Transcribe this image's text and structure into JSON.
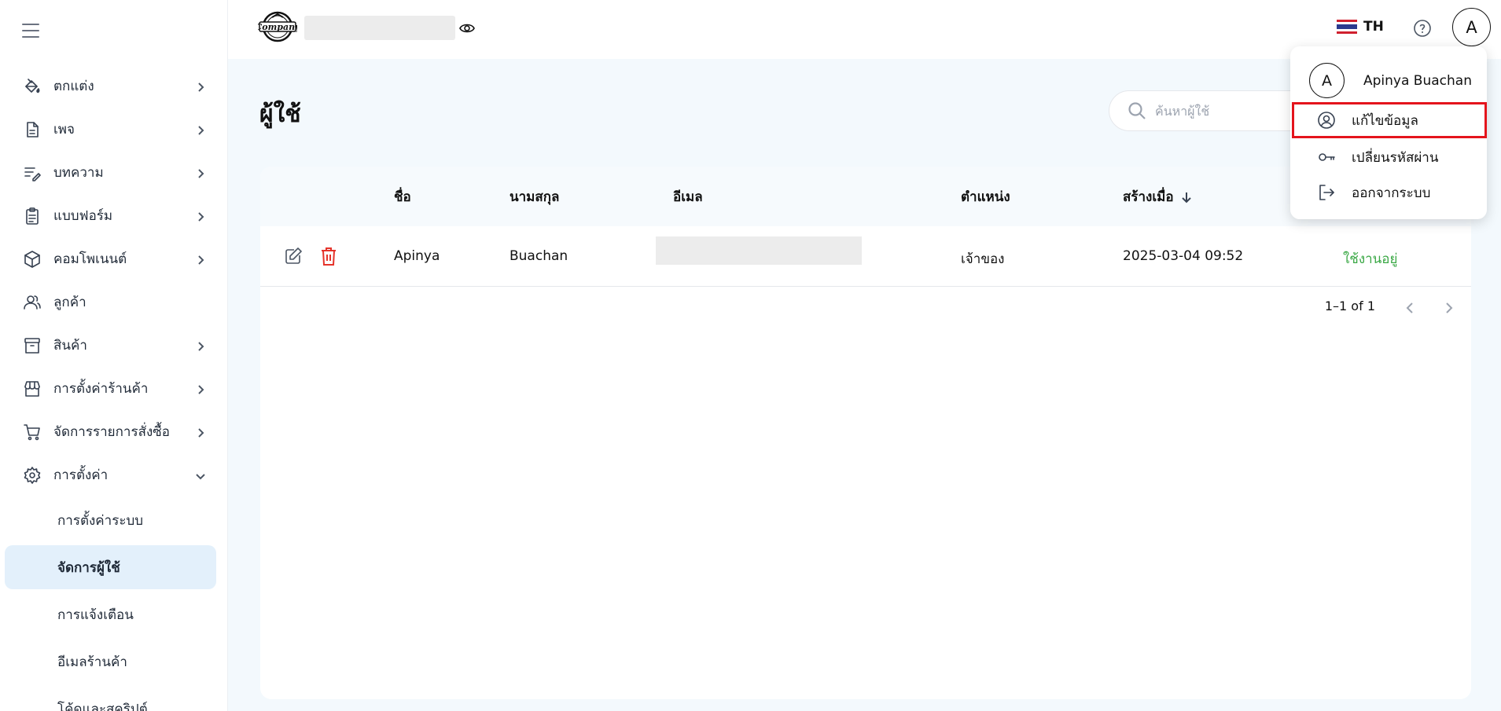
{
  "sidebar": {
    "items": [
      {
        "label": "ตกแต่ง",
        "icon": "paint-bucket-icon",
        "has_chevron": true
      },
      {
        "label": "เพจ",
        "icon": "page-icon",
        "has_chevron": true
      },
      {
        "label": "บทความ",
        "icon": "article-edit-icon",
        "has_chevron": true
      },
      {
        "label": "แบบฟอร์ม",
        "icon": "clipboard-icon",
        "has_chevron": true
      },
      {
        "label": "คอมโพเนนต์",
        "icon": "cube-icon",
        "has_chevron": true
      },
      {
        "label": "ลูกค้า",
        "icon": "customers-icon",
        "has_chevron": false
      },
      {
        "label": "สินค้า",
        "icon": "archive-box-icon",
        "has_chevron": true
      },
      {
        "label": "การตั้งค่าร้านค้า",
        "icon": "storefront-icon",
        "has_chevron": true
      },
      {
        "label": "จัดการรายการสั่งซื้อ",
        "icon": "cart-icon",
        "has_chevron": true
      },
      {
        "label": "การตั้งค่า",
        "icon": "gear-icon",
        "has_chevron": true,
        "expanded": true
      }
    ],
    "sub_items": [
      {
        "label": "การตั้งค่าระบบ",
        "active": false
      },
      {
        "label": "จัดการผู้ใช้",
        "active": true
      },
      {
        "label": "การแจ้งเตือน",
        "active": false
      },
      {
        "label": "อีเมลร้านค้า",
        "active": false
      },
      {
        "label": "โค้ดและสคริปต์",
        "active": false
      }
    ]
  },
  "header": {
    "logo_text": "Company",
    "language": "TH",
    "avatar_initial": "A"
  },
  "main": {
    "title": "ผู้ใช้",
    "search_placeholder": "ค้นหาผู้ใช้"
  },
  "table": {
    "columns": {
      "first_name": "ชื่อ",
      "last_name": "นามสกุล",
      "email": "อีเมล",
      "role": "ตำแหน่ง",
      "created_at": "สร้างเมื่อ"
    },
    "rows": [
      {
        "first_name": "Apinya",
        "last_name": "Buachan",
        "email": "",
        "role": "เจ้าของ",
        "created_at": "2025-03-04 09:52",
        "status": "ใช้งานอยู่"
      }
    ],
    "pagination": "1–1 of 1"
  },
  "user_menu": {
    "avatar_initial": "A",
    "user_name": "Apinya Buachan",
    "items": [
      {
        "label": "แก้ไขข้อมูล",
        "icon": "user-circle-icon"
      },
      {
        "label": "เปลี่ยนรหัสผ่าน",
        "icon": "key-icon"
      },
      {
        "label": "ออกจากระบบ",
        "icon": "logout-icon"
      }
    ]
  },
  "colors": {
    "accent_active": "#e3f0fb",
    "status_active": "#3aa845",
    "delete": "#e5332a",
    "highlight_border": "#e4141c",
    "flag_red": "#d0202e",
    "flag_blue": "#2b3a8f"
  }
}
